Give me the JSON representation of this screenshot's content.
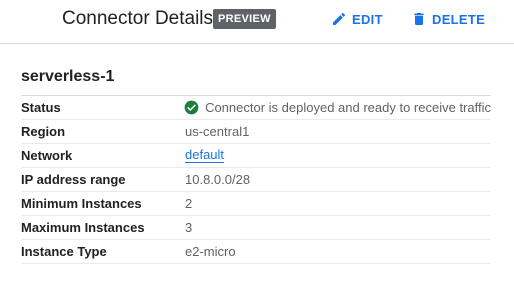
{
  "header": {
    "title": "Connector Details",
    "badge": "PREVIEW",
    "edit_label": "EDIT",
    "delete_label": "DELETE",
    "edit_icon": "pencil-icon",
    "delete_icon": "trash-icon"
  },
  "connector": {
    "name": "serverless-1"
  },
  "details": {
    "status": {
      "label": "Status",
      "value": "Connector is deployed and ready to receive traffic",
      "icon": "check-circle-icon",
      "color": "#188038"
    },
    "region": {
      "label": "Region",
      "value": "us-central1"
    },
    "network": {
      "label": "Network",
      "value": "default"
    },
    "ip_range": {
      "label": "IP address range",
      "value": "10.8.0.0/28"
    },
    "min_instances": {
      "label": "Minimum Instances",
      "value": "2"
    },
    "max_instances": {
      "label": "Maximum Instances",
      "value": "3"
    },
    "instance_type": {
      "label": "Instance Type",
      "value": "e2-micro"
    }
  },
  "colors": {
    "accent": "#1a73e8",
    "badge_bg": "#5f6368",
    "success": "#188038"
  }
}
